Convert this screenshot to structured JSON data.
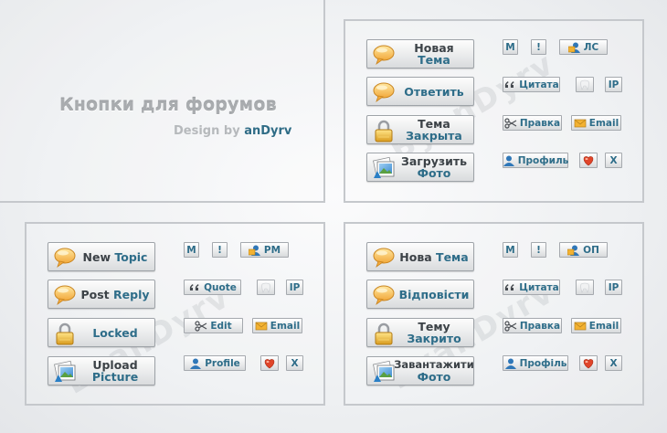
{
  "title": "Кнопки для форумов",
  "subtitle_prefix": "Design by",
  "author": "anDyrv",
  "watermark": "ByanDyrv",
  "colors": {
    "accent": "#2e6d89",
    "text": "#3c4247",
    "panel_border": "#c5c8cc"
  },
  "panels": {
    "russian": {
      "big": [
        {
          "icon": "speech-bubble-icon",
          "text": "Новая",
          "hl": "Тема"
        },
        {
          "icon": "speech-bubble-icon",
          "text": "",
          "hl": "Ответить"
        },
        {
          "icon": "padlock-icon",
          "text": "Тема",
          "hl": "Закрыта"
        },
        {
          "icon": "photo-icon",
          "text": "Загрузить",
          "hl": "Фото"
        }
      ],
      "small": {
        "m": "M",
        "excl": "!",
        "pm": "ЛС",
        "quote": "Цитата",
        "ip": "IP",
        "edit": "Правка",
        "email": "Email",
        "profile": "Профиль",
        "x": "X"
      }
    },
    "english": {
      "big": [
        {
          "icon": "speech-bubble-icon",
          "text": "New",
          "hl": "Topic"
        },
        {
          "icon": "speech-bubble-icon",
          "text": "Post",
          "hl": "Reply"
        },
        {
          "icon": "padlock-icon",
          "text": "",
          "hl": "Locked"
        },
        {
          "icon": "photo-icon",
          "text": "Upload",
          "hl": "Picture"
        }
      ],
      "small": {
        "m": "M",
        "excl": "!",
        "pm": "PM",
        "quote": "Quote",
        "ip": "IP",
        "edit": "Edit",
        "email": "Email",
        "profile": "Profile",
        "x": "X"
      }
    },
    "ukrainian": {
      "big": [
        {
          "icon": "speech-bubble-icon",
          "text": "Нова",
          "hl": "Тема"
        },
        {
          "icon": "speech-bubble-icon",
          "text": "",
          "hl": "Відповісти"
        },
        {
          "icon": "padlock-icon",
          "text": "Тему",
          "hl": "Закрито"
        },
        {
          "icon": "photo-icon",
          "text": "Завантажити",
          "hl": "Фото"
        }
      ],
      "small": {
        "m": "M",
        "excl": "!",
        "pm": "ОП",
        "quote": "Цитата",
        "ip": "IP",
        "edit": "Правка",
        "email": "Email",
        "profile": "Профіль",
        "x": "X"
      }
    }
  }
}
